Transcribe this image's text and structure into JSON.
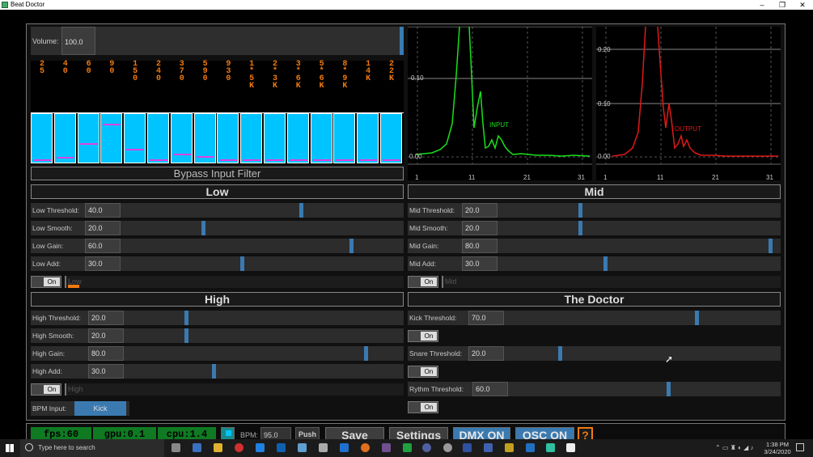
{
  "window": {
    "title": "Beat Doctor",
    "minimize": "–",
    "maximize": "❐",
    "close": "✕"
  },
  "volume": {
    "label": "Volume:",
    "value": "100.0"
  },
  "freq_columns": [
    [
      "2",
      "5"
    ],
    [
      "4",
      "0"
    ],
    [
      "6",
      "0"
    ],
    [
      "9",
      "0"
    ],
    [
      "1",
      "5",
      "0"
    ],
    [
      "2",
      "4",
      "0"
    ],
    [
      "3",
      "7",
      "0"
    ],
    [
      "5",
      "9",
      "0"
    ],
    [
      "9",
      "3",
      "0"
    ],
    [
      "1",
      "*",
      "5",
      "K"
    ],
    [
      "2",
      "*",
      "3",
      "K"
    ],
    [
      "3",
      "*",
      "6",
      "K"
    ],
    [
      "5",
      "*",
      "6",
      "K"
    ],
    [
      "8",
      "*",
      "9",
      "K"
    ],
    [
      "1",
      "4",
      "K"
    ],
    [
      "2",
      "2",
      "K"
    ]
  ],
  "eq_markers": [
    0.97,
    0.92,
    0.62,
    0.2,
    0.74,
    0.97,
    0.84,
    0.9,
    0.97,
    0.97,
    0.97,
    0.97,
    0.97,
    0.97,
    0.97,
    0.97
  ],
  "bypass_label": "Bypass Input Filter",
  "sections": {
    "low": "Low",
    "mid": "Mid",
    "high": "High",
    "doctor": "The Doctor"
  },
  "low": {
    "rows": [
      {
        "label": "Low Threshold:",
        "value": "40.0",
        "level": 0.64
      },
      {
        "label": "Low Smooth:",
        "value": "20.0",
        "level": 0.29
      },
      {
        "label": "Low Gain:",
        "value": "60.0",
        "level": 0.82
      },
      {
        "label": "Low Add:",
        "value": "30.0",
        "level": 0.43
      }
    ],
    "toggle": "On",
    "meter_label": "Low"
  },
  "mid": {
    "rows": [
      {
        "label": "Mid Threshold:",
        "value": "20.0",
        "level": 0.29
      },
      {
        "label": "Mid Smooth:",
        "value": "20.0",
        "level": 0.29
      },
      {
        "label": "Mid Gain:",
        "value": "80.0",
        "level": 0.97
      },
      {
        "label": "Mid Add:",
        "value": "30.0",
        "level": 0.38
      }
    ],
    "toggle": "On",
    "meter_label": "Mid"
  },
  "high": {
    "rows": [
      {
        "label": "High Threshold:",
        "value": "20.0",
        "level": 0.22
      },
      {
        "label": "High Smooth:",
        "value": "20.0",
        "level": 0.22
      },
      {
        "label": "High Gain:",
        "value": "80.0",
        "level": 0.87
      },
      {
        "label": "High Add:",
        "value": "30.0",
        "level": 0.32
      }
    ],
    "toggle": "On",
    "meter_label": "High",
    "bpm_input_label": "BPM Input:",
    "bpm_input_value": "Kick"
  },
  "doctor": {
    "kick": {
      "label": "Kick Threshold:",
      "value": "70.0",
      "level": 0.7
    },
    "snare": {
      "label": "Snare Threshold:",
      "value": "20.0",
      "level": 0.2
    },
    "rythm": {
      "label": "Rythm Threshold:",
      "value": "60.0",
      "level": 0.59
    },
    "toggle": "On"
  },
  "graphs": {
    "input": {
      "label": "INPUT",
      "y_ticks": [
        "0.10",
        "0.00"
      ],
      "x_ticks": [
        "1",
        "11",
        "21",
        "31"
      ],
      "color": "#19e019"
    },
    "output": {
      "label": "OUTPUT",
      "y_ticks": [
        "0.20",
        "0.10",
        "0.00"
      ],
      "x_ticks": [
        "1",
        "11",
        "21",
        "31"
      ],
      "color": "#e01919"
    }
  },
  "bottom": {
    "fps": "fps:60",
    "gpu": "gpu:0.1",
    "cpu": "cpu:1.4",
    "bpm_label": "BPM:",
    "bpm_value": "95.0",
    "push": "Push",
    "save": "Save",
    "settings": "Settings",
    "dmx": "DMX ON",
    "osc": "OSC ON",
    "help": "?"
  },
  "taskbar": {
    "search_placeholder": "Type here to search",
    "time": "1:38 PM",
    "date": "3/24/2020"
  }
}
